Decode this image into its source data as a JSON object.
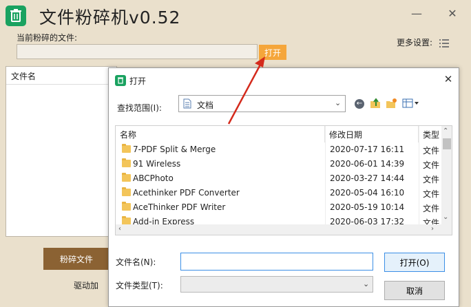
{
  "app": {
    "title": "文件粉碎机v0.52",
    "label_current_file": "当前粉碎的文件:",
    "open_button": "打开",
    "more_settings": "更多设置:",
    "list_header": "文件名",
    "shred_button": "粉碎文件",
    "driver_label": "驱动加",
    "accent_color": "#f5a63b",
    "shred_color": "#8b6233",
    "logo_color": "#1aa260"
  },
  "dialog": {
    "title": "打开",
    "look_in_label": "查找范围(I):",
    "look_in_value": "文档",
    "columns": {
      "name": "名称",
      "date": "修改日期",
      "type": "类型"
    },
    "rows": [
      {
        "name": "7-PDF Split & Merge",
        "date": "2020-07-17 16:11",
        "type": "文件"
      },
      {
        "name": "91 Wireless",
        "date": "2020-06-01 14:39",
        "type": "文件"
      },
      {
        "name": "ABCPhoto",
        "date": "2020-03-27 14:44",
        "type": "文件"
      },
      {
        "name": "Acethinker PDF Converter",
        "date": "2020-05-04 16:10",
        "type": "文件"
      },
      {
        "name": "AceThinker PDF Writer",
        "date": "2020-05-19 10:14",
        "type": "文件"
      },
      {
        "name": "Add-in Express",
        "date": "2020-06-03 17:32",
        "type": "文件"
      }
    ],
    "file_name_label": "文件名(N):",
    "file_name_value": "",
    "file_type_label": "文件类型(T):",
    "open_button": "打开(O)",
    "cancel_button": "取消",
    "icons": {
      "back": "back-arrow-icon",
      "up": "up-folder-icon",
      "new_folder": "new-folder-icon",
      "view": "view-menu-icon"
    }
  }
}
